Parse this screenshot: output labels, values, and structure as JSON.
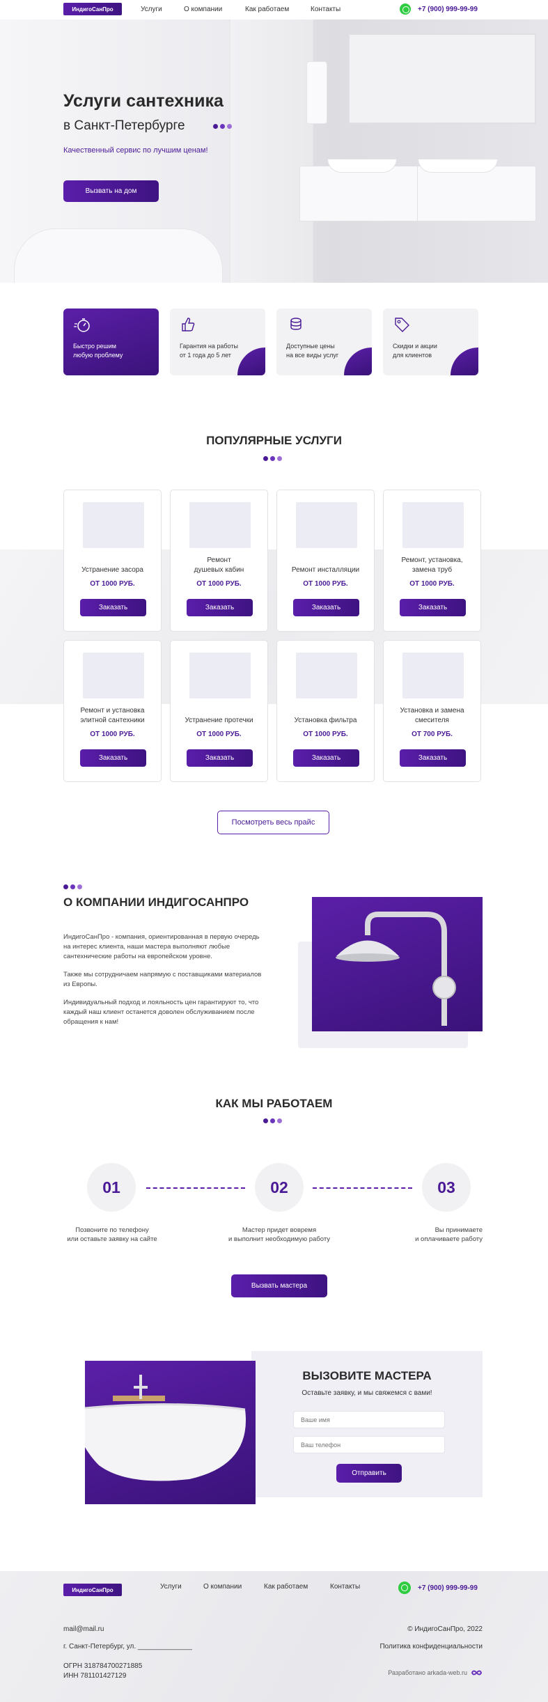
{
  "header": {
    "logo": "ИндигоСанПро",
    "nav": [
      "Услуги",
      "О компании",
      "Как работаем",
      "Контакты"
    ],
    "phone": "+7 (900) 999-99-99"
  },
  "hero": {
    "title": "Услуги сантехника",
    "subtitle": "в Санкт-Петербурге",
    "tagline": "Качественный сервис по лучшим ценам!",
    "cta": "Вызвать на дом"
  },
  "features": [
    {
      "label": "Быстро решим\nлюбую проблему",
      "icon": "stopwatch-icon"
    },
    {
      "label": "Гарантия на работы\nот 1 года до 5 лет",
      "icon": "thumbs-up-icon"
    },
    {
      "label": "Доступные цены\nна все виды услуг",
      "icon": "coins-icon"
    },
    {
      "label": "Скидки и акции\nдля клиентов",
      "icon": "tag-icon"
    }
  ],
  "services": {
    "title": "ПОПУЛЯРНЫЕ УСЛУГИ",
    "order_label": "Заказать",
    "items": [
      {
        "name": "Устранение засора",
        "price": "ОТ 1000 РУБ.",
        "image": "plunger-image"
      },
      {
        "name": "Ремонт\nдушевых кабин",
        "price": "ОТ 1000 РУБ.",
        "image": "shower-cabin-image"
      },
      {
        "name": "Ремонт инсталляции",
        "price": "ОТ 1000 РУБ.",
        "image": "toilet-image"
      },
      {
        "name": "Ремонт, установка,\nзамена труб",
        "price": "ОТ 1000 РУБ.",
        "image": "pipes-image"
      },
      {
        "name": "Ремонт и установка\nэлитной сантехники",
        "price": "ОТ 1000 РУБ.",
        "image": "sink-bowl-image"
      },
      {
        "name": "Устранение протечки",
        "price": "ОТ 1000 РУБ.",
        "image": "valves-image"
      },
      {
        "name": "Установка фильтра",
        "price": "ОТ 1000 РУБ.",
        "image": "water-filter-image"
      },
      {
        "name": "Установка и замена\nсмесителя",
        "price": "ОТ 700 РУБ.",
        "image": "mixer-image"
      }
    ],
    "all_prices": "Посмотреть весь прайс"
  },
  "about": {
    "title": "О КОМПАНИИ ИНДИГОСАНПРО",
    "paragraphs": [
      "ИндигоСанПро - компания, ориентированная в первую очередь на интерес клиента, наши мастера выполняют любые сантехнические работы на европейском уровне.",
      "Также мы сотрудничаем напрямую с поставщиками материалов из Европы.",
      "Индивидуальный подход и лояльность цен гарантируют то, что каждый наш клиент останется доволен обслуживанием после обращения к нам!"
    ]
  },
  "how": {
    "title": "КАК МЫ РАБОТАЕМ",
    "steps": [
      {
        "num": "01",
        "text": "Позвоните по телефону\nили оставьте заявку на сайте"
      },
      {
        "num": "02",
        "text": "Мастер придет вовремя\nи выполнит необходимую работу"
      },
      {
        "num": "03",
        "text": "Вы принимаете\nи оплачиваете работу"
      }
    ],
    "cta": "Вызвать мастера"
  },
  "callback": {
    "title": "ВЫЗОВИТЕ МАСТЕРА",
    "subtitle": "Оставьте заявку, и мы свяжемся с вами!",
    "name_placeholder": "Ваше имя",
    "phone_placeholder": "Ваш телефон",
    "submit": "Отправить"
  },
  "footer": {
    "logo": "ИндигоСанПро",
    "nav": [
      "Услуги",
      "О компании",
      "Как работаем",
      "Контакты"
    ],
    "phone": "+7 (900) 999-99-99",
    "email": "mail@mail.ru",
    "address": "г. Санкт-Петербург, ул. ______________",
    "ogrn": "ОГРН 318784700271885",
    "inn": "ИНН 781101427129",
    "copyright": "© ИндигоСанПро, 2022",
    "privacy": "Политика конфиденциальности",
    "developer": "Разработано arkada-web.ru"
  },
  "colors": {
    "accent": "#4a1a96",
    "accent_light": "#9d6fd6",
    "accent_mid": "#6a34bd",
    "whatsapp": "#2ecc40"
  }
}
